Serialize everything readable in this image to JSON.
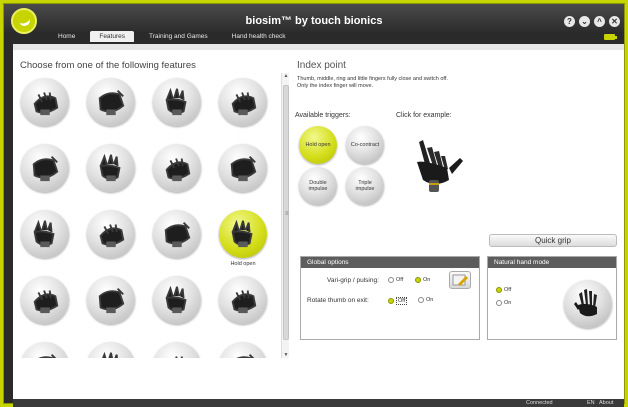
{
  "window": {
    "title": "biosim™ by touch bionics",
    "buttons": [
      "?",
      "⌄",
      "^",
      "✕"
    ],
    "accent": "#c8d400"
  },
  "tabs": [
    {
      "label": "Home",
      "active": false
    },
    {
      "label": "Features",
      "active": true
    },
    {
      "label": "Training and Games",
      "active": false
    },
    {
      "label": "Hand health check",
      "active": false
    }
  ],
  "features": {
    "heading": "Choose from one of the following features",
    "items": [
      {
        "icon": "hand-fist-icon",
        "selected": false
      },
      {
        "icon": "hand-fist-icon",
        "selected": false
      },
      {
        "icon": "hand-grip-icon",
        "selected": false
      },
      {
        "icon": "hand-open-icon",
        "selected": false
      },
      {
        "icon": "hand-grip-icon",
        "selected": false
      },
      {
        "icon": "hand-fist-icon",
        "selected": false
      },
      {
        "icon": "hand-open-icon",
        "selected": false
      },
      {
        "icon": "hand-point-icon",
        "selected": false
      },
      {
        "icon": "hand-point-icon",
        "selected": false
      },
      {
        "icon": "hand-point-icon",
        "selected": false
      },
      {
        "icon": "hand-point-icon",
        "selected": false
      },
      {
        "icon": "hand-index-point-icon",
        "selected": true,
        "caption": "Hold open"
      },
      {
        "icon": "hand-rock-icon",
        "selected": false
      },
      {
        "icon": "hand-pinch-icon",
        "selected": false
      },
      {
        "icon": "hand-open-icon",
        "selected": false
      },
      {
        "icon": "hand-mouse-icon",
        "selected": false
      },
      {
        "icon": "hand-partial-icon",
        "selected": false
      },
      {
        "icon": "hand-partial-icon",
        "selected": false
      },
      {
        "icon": "hand-partial-icon",
        "selected": false
      },
      {
        "icon": "hand-partial-icon",
        "selected": false
      }
    ]
  },
  "detail": {
    "title": "Index point",
    "description_line1": "Thumb, middle, ring and little fingers fully close and switch off.",
    "description_line2": "Only the index finger will move.",
    "available_triggers_label": "Available triggers:",
    "click_example_label": "Click for example:",
    "triggers": [
      {
        "label": "Hold open",
        "active": true
      },
      {
        "label": "Co-contract",
        "active": false
      },
      {
        "label": "Double impulse",
        "active": false
      },
      {
        "label": "Triple impulse",
        "active": false
      }
    ],
    "quick_grip_label": "Quick grip"
  },
  "global_options": {
    "heading": "Global options",
    "vari_grip_label": "Vari-grip / pulsing:",
    "vari_grip_off": "Off",
    "vari_grip_on": "On",
    "vari_grip_value": "On",
    "rotate_thumb_label": "Rotate thumb on exit:",
    "rotate_off": "Off",
    "rotate_on": "On",
    "rotate_value": "Off"
  },
  "natural_hand_mode": {
    "heading": "Natural hand mode",
    "off_label": "Off",
    "on_label": "On",
    "value": "Off"
  },
  "status_bar": {
    "connection": "Connected",
    "language": "EN",
    "about": "About"
  }
}
